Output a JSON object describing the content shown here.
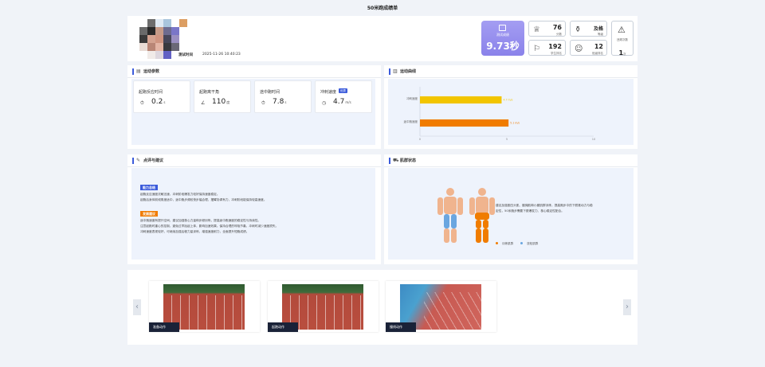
{
  "page": {
    "title": "50米跑成绩单"
  },
  "profile": {
    "test_time_label": "测试时间",
    "test_time": "2025-11-26 10:40:23"
  },
  "score": {
    "label": "测试成绩",
    "value": "9.73秒"
  },
  "stats": [
    {
      "value": "76",
      "label": "分数",
      "icon": "trophy-icon"
    },
    {
      "value": "及格",
      "label": "等级",
      "icon": "medal-icon"
    },
    {
      "value": "192",
      "label": "学生排名",
      "icon": "ranking-icon"
    },
    {
      "value": "12",
      "label": "班级排名",
      "icon": "users-icon"
    },
    {
      "value": "1",
      "unit": "次",
      "label": "违规次数",
      "icon": "warning-icon"
    }
  ],
  "params": {
    "title": "运动参数",
    "items": [
      {
        "name": "起跑反应时间",
        "value": "0.2",
        "unit": "s",
        "icon": "timer-icon"
      },
      {
        "name": "起跑离干角",
        "value": "110",
        "unit": "度",
        "icon": "angle-icon"
      },
      {
        "name": "途中跑时间",
        "value": "7.8",
        "unit": "s",
        "icon": "timer-icon"
      },
      {
        "name": "冲刺速度",
        "value": "4.7",
        "unit": "m/s",
        "icon": "speedometer-icon",
        "badge": "优秀"
      }
    ]
  },
  "curve": {
    "title": "运动曲线"
  },
  "chart_data": {
    "type": "bar",
    "orientation": "horizontal",
    "categories": [
      "冲刺速度",
      "途中跑速度"
    ],
    "values": [
      4.7,
      5.1
    ],
    "data_labels": [
      "4.7 m/s",
      "5.1 m/s"
    ],
    "colors": [
      "#f2c500",
      "#f07c00"
    ],
    "xlim": [
      0,
      10
    ],
    "xticks": [
      "0",
      "5",
      "10"
    ]
  },
  "advice": {
    "title": "点评与建议",
    "tag1": "能力总结",
    "text1": [
      "起跑反应速度灵敏迅速，冲刺阶段爆发力较好保持速度稳定。",
      "起跑后身体前倾角度适中，途中跑步频较快步幅合理，摆臂协调有力，冲刺阶段能保持较高速度。"
    ],
    "tag2": "发展建议",
    "text2": [
      "途中跑速度有提升空间，建议加强核心力量和步频训练，提高途中跑速度的稳定性与持续性。",
      "注意起跑时重心的控制，避免过早抬起上体，影响加速效果。保持合理的呼吸节奏，冲刺时减少速度损失。",
      "冲刺速度表现较好，可继续加强后程力量训练，增强速度耐力，全面提升短跑成绩。"
    ]
  },
  "muscles": {
    "title": "肌群状态",
    "desc": "建议加强股四头肌、腘绳肌和小腿肌群训练，提高跑步中的下肢推动力与稳定性，50米跑步需要下肢爆发力、核心稳定性配合。",
    "legend1": "训练肌群",
    "legend2": "放松肌群"
  },
  "photos": [
    {
      "caption": "准备动作"
    },
    {
      "caption": "起跑动作"
    },
    {
      "caption": "撞线动作"
    }
  ],
  "colors": {
    "accent": "#3b5bdb",
    "score_bg": "#9b93f0",
    "primary_bar": "#f07c00",
    "secondary_bar": "#f2c500"
  }
}
